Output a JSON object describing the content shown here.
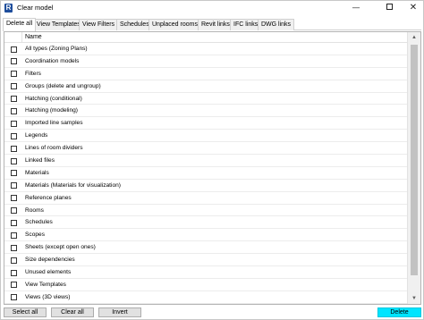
{
  "window": {
    "title": "Clear model",
    "app_icon_letter": "R",
    "controls": {
      "minimize": "—",
      "close": "✕"
    }
  },
  "tabs": [
    {
      "label": "Delete all",
      "active": true
    },
    {
      "label": "View Templates",
      "active": false
    },
    {
      "label": "View Filters",
      "active": false
    },
    {
      "label": "Schedules",
      "active": false
    },
    {
      "label": "Unplaced rooms",
      "active": false
    },
    {
      "label": "Revit links",
      "active": false
    },
    {
      "label": "IFC links",
      "active": false
    },
    {
      "label": "DWG links",
      "active": false
    }
  ],
  "list": {
    "column_header": "Name",
    "items": [
      "All types (Zoning Plans)",
      "Coordination models",
      "Filters",
      "Groups (delete and ungroup)",
      "Hatching (conditional)",
      "Hatching (modeling)",
      "Imported line samples",
      "Legends",
      "Lines of room dividers",
      "Linked files",
      "Materials",
      "Materials (Materials for visualization)",
      "Reference planes",
      "Rooms",
      "Schedules",
      "Scopes",
      "Sheets (except open ones)",
      "Size dependencies",
      "Unused elements",
      "View Templates",
      "Views (3D views)"
    ]
  },
  "buttons": {
    "select_all": "Select all",
    "clear_all": "Clear all",
    "invert": "Invert",
    "delete": "Delete"
  },
  "colors": {
    "delete_button": "#00e5ff",
    "app_icon": "#1f4e9c"
  }
}
